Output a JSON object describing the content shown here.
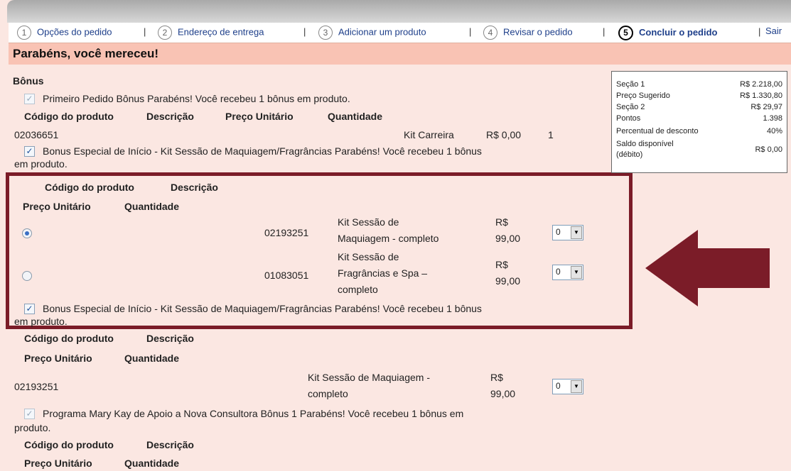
{
  "steps": [
    {
      "num": "1",
      "label": "Opções do pedido"
    },
    {
      "num": "2",
      "label": "Endereço de entrega"
    },
    {
      "num": "3",
      "label": "Adicionar um produto"
    },
    {
      "num": "4",
      "label": "Revisar o pedido"
    },
    {
      "num": "5",
      "label": "Concluir o pedido"
    }
  ],
  "step_sep": "|",
  "sair": "Sair",
  "header_title": "Parabéns, você mereceu!",
  "bonus_title": "Bônus",
  "cols": {
    "codigo": "Código do produto",
    "descricao": "Descrição",
    "preco": "Preço Unitário",
    "quantidade": "Quantidade"
  },
  "bonus1": {
    "text": "Primeiro Pedido Bônus Parabéns! Você recebeu 1 bônus em produto.",
    "code": "02036651",
    "desc": "Kit Carreira",
    "price": "R$ 0,00",
    "qty": "1"
  },
  "bonus2": {
    "text_line1": "Bonus Especial de Início - Kit Sessão de Maquiagem/Fragrâncias Parabéns! Você recebeu 1 bônus",
    "text_line2": "em produto.",
    "options": [
      {
        "code": "02193251",
        "desc_l1": "Kit Sessão de",
        "desc_l2": "Maquiagem - completo",
        "desc_l3": "",
        "price_l1": "R$",
        "price_l2": "99,00",
        "qty": "0",
        "selected": true
      },
      {
        "code": "01083051",
        "desc_l1": "Kit Sessão de",
        "desc_l2": "Fragrâncias e Spa –",
        "desc_l3": "completo",
        "price_l1": "R$",
        "price_l2": "99,00",
        "qty": "0",
        "selected": false
      }
    ]
  },
  "bonus3": {
    "text_line1": "Bonus Especial de Início - Kit Sessão de Maquiagem/Fragrâncias Parabéns! Você recebeu 1 bônus",
    "text_line2": "em produto.",
    "code": "02193251",
    "desc_l1": "Kit Sessão de Maquiagem -",
    "desc_l2": "completo",
    "price_l1": "R$",
    "price_l2": "99,00",
    "qty": "0"
  },
  "bonus4": {
    "text_line1": "Programa Mary Kay de Apoio a Nova Consultora Bônus 1 Parabéns! Você recebeu 1 bônus em",
    "text_line2": "produto."
  },
  "summary": [
    {
      "k": "Seção 1",
      "v": "R$ 2.218,00"
    },
    {
      "k": "Preço Sugerido",
      "v": "R$ 1.330,80"
    },
    {
      "k": "Seção 2",
      "v": "R$ 29,97"
    },
    {
      "k": "Pontos",
      "v": "1.398"
    },
    {
      "k": "Percentual de desconto",
      "v": "40%"
    },
    {
      "k": "Saldo disponível",
      "k2": "(débito)",
      "v": "R$ 0,00"
    }
  ],
  "colors": {
    "highlight": "#7b1c28",
    "header_bg": "#f9c3b4",
    "page_bg": "#fbe7e2"
  }
}
